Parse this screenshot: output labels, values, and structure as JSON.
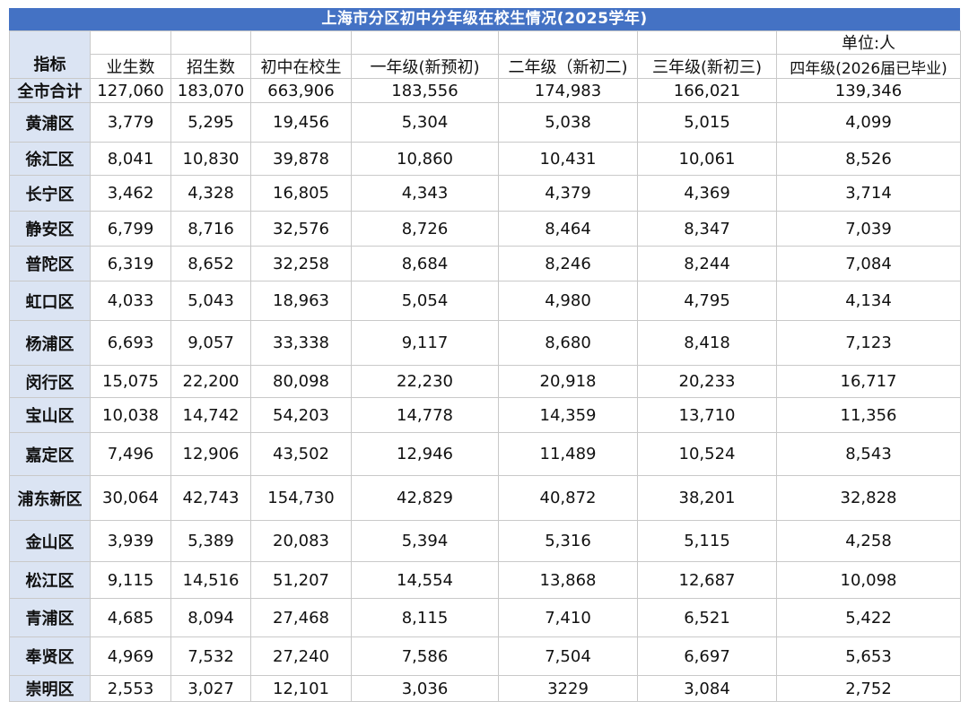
{
  "title": "上海市分区初中分年级在校生情况(2025学年)",
  "unit_note": "单位:人",
  "header": {
    "row_label": "指标",
    "columns": [
      "业生数",
      "招生数",
      "初中在校生",
      "一年级(新预初)",
      "二年级（新初二)",
      "三年级(新初三)",
      "四年级(2026届已毕业)"
    ]
  },
  "rows": [
    {
      "name": "全市合计",
      "values": [
        "127,060",
        "183,070",
        "663,906",
        "183,556",
        "174,983",
        "166,021",
        "139,346"
      ]
    },
    {
      "name": "黄浦区",
      "values": [
        "3,779",
        "5,295",
        "19,456",
        "5,304",
        "5,038",
        "5,015",
        "4,099"
      ]
    },
    {
      "name": "徐汇区",
      "values": [
        "8,041",
        "10,830",
        "39,878",
        "10,860",
        "10,431",
        "10,061",
        "8,526"
      ]
    },
    {
      "name": "长宁区",
      "values": [
        "3,462",
        "4,328",
        "16,805",
        "4,343",
        "4,379",
        "4,369",
        "3,714"
      ]
    },
    {
      "name": "静安区",
      "values": [
        "6,799",
        "8,716",
        "32,576",
        "8,726",
        "8,464",
        "8,347",
        "7,039"
      ]
    },
    {
      "name": "普陀区",
      "values": [
        "6,319",
        "8,652",
        "32,258",
        "8,684",
        "8,246",
        "8,244",
        "7,084"
      ]
    },
    {
      "name": "虹口区",
      "values": [
        "4,033",
        "5,043",
        "18,963",
        "5,054",
        "4,980",
        "4,795",
        "4,134"
      ]
    },
    {
      "name": "杨浦区",
      "values": [
        "6,693",
        "9,057",
        "33,338",
        "9,117",
        "8,680",
        "8,418",
        "7,123"
      ]
    },
    {
      "name": "闵行区",
      "values": [
        "15,075",
        "22,200",
        "80,098",
        "22,230",
        "20,918",
        "20,233",
        "16,717"
      ]
    },
    {
      "name": "宝山区",
      "values": [
        "10,038",
        "14,742",
        "54,203",
        "14,778",
        "14,359",
        "13,710",
        "11,356"
      ]
    },
    {
      "name": "嘉定区",
      "values": [
        "7,496",
        "12,906",
        "43,502",
        "12,946",
        "11,489",
        "10,524",
        "8,543"
      ]
    },
    {
      "name": "浦东新区",
      "values": [
        "30,064",
        "42,743",
        "154,730",
        "42,829",
        "40,872",
        "38,201",
        "32,828"
      ]
    },
    {
      "name": "金山区",
      "values": [
        "3,939",
        "5,389",
        "20,083",
        "5,394",
        "5,316",
        "5,115",
        "4,258"
      ]
    },
    {
      "name": "松江区",
      "values": [
        "9,115",
        "14,516",
        "51,207",
        "14,554",
        "13,868",
        "12,687",
        "10,098"
      ]
    },
    {
      "name": "青浦区",
      "values": [
        "4,685",
        "8,094",
        "27,468",
        "8,115",
        "7,410",
        "6,521",
        "5,422"
      ]
    },
    {
      "name": "奉贤区",
      "values": [
        "4,969",
        "7,532",
        "27,240",
        "7,586",
        "7,504",
        "6,697",
        "5,653"
      ]
    },
    {
      "name": "崇明区",
      "values": [
        "2,553",
        "3,027",
        "12,101",
        "3,036",
        "3229",
        "3,084",
        "2,752"
      ]
    }
  ],
  "colors": {
    "title_bg": "#4472c4",
    "label_bg": "#dbe4f3",
    "grid": "#c9c9c9"
  }
}
